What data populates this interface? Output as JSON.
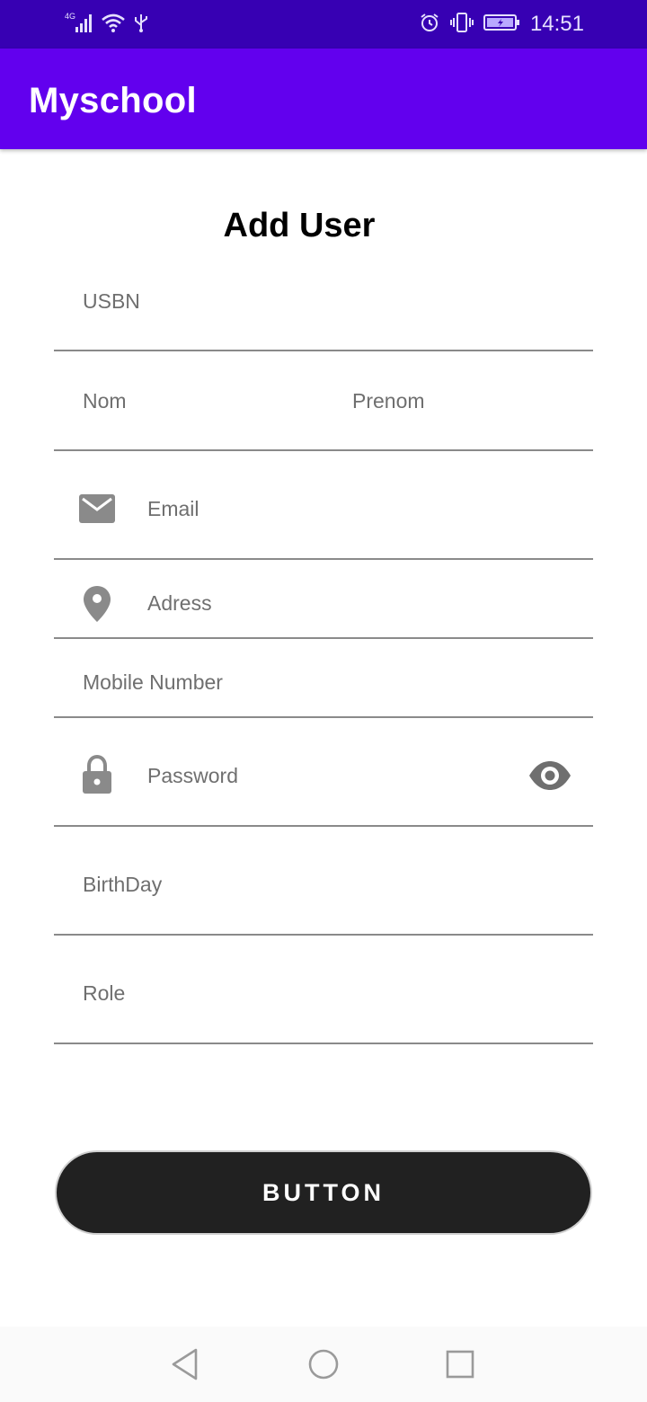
{
  "status_bar": {
    "network_label": "4G",
    "time": "14:51",
    "icons": [
      "signal-icon",
      "wifi-icon",
      "usb-icon",
      "alarm-icon",
      "vibrate-icon",
      "battery-charging-icon"
    ]
  },
  "app_bar": {
    "title": "Myschool"
  },
  "form": {
    "title": "Add User",
    "usbn_hint": "USBN",
    "nom_hint": "Nom",
    "prenom_hint": "Prenom",
    "email_hint": "Email",
    "adress_hint": "Adress",
    "mobile_hint": "Mobile Number",
    "password_hint": "Password",
    "birthday_hint": "BirthDay",
    "role_hint": "Role",
    "submit_label": "BUTTON"
  },
  "colors": {
    "status_bar": "#3700b3",
    "app_bar": "#6200ee",
    "button": "#212121",
    "icon": "#8a8a8a"
  },
  "nav_bar": {
    "icons": [
      "back-icon",
      "home-icon",
      "recents-icon"
    ]
  }
}
